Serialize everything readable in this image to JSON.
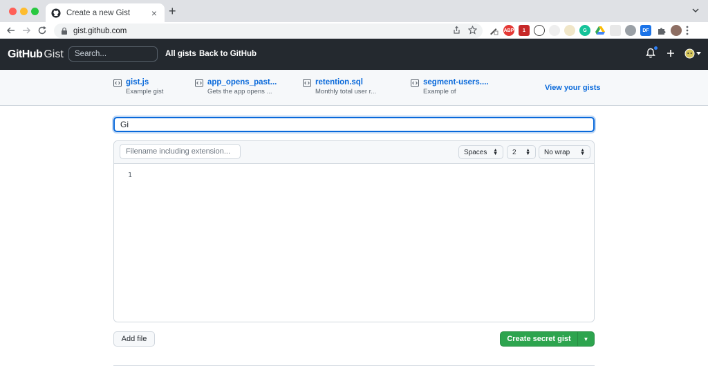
{
  "browser": {
    "tab_title": "Create a new Gist",
    "url": "gist.github.com"
  },
  "header": {
    "logo_github": "GitHub",
    "logo_gist": "Gist",
    "search_placeholder": "Search...",
    "nav": [
      "All gists",
      "Back to GitHub"
    ]
  },
  "recent_gists": [
    {
      "name": "gist.js",
      "desc": "Example gist"
    },
    {
      "name": "app_opens_past...",
      "desc": "Gets the app opens ..."
    },
    {
      "name": "retention.sql",
      "desc": "Monthly total user r..."
    },
    {
      "name": "segment-users....",
      "desc": "Example of"
    }
  ],
  "view_your_gists": "View your gists",
  "form": {
    "description_value": "Gi",
    "filename_placeholder": "Filename including extension...",
    "indent_mode": "Spaces",
    "indent_size": "2",
    "wrap_mode": "No wrap",
    "line_number": "1",
    "add_file_label": "Add file",
    "create_label": "Create secret gist"
  },
  "colors": {
    "header_bg": "#24292f",
    "link": "#0969da",
    "primary_button": "#2da44e",
    "focus_border": "#0969da"
  }
}
